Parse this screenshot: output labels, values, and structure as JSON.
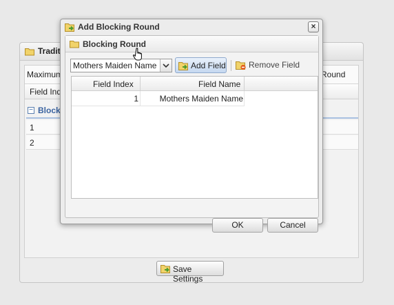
{
  "background": {
    "panel_title": "Traditional",
    "maximum_label": "Maximum",
    "round_label": "Round",
    "field_index_label": "Field Index",
    "blocking_label": "Blocking",
    "rows": [
      "1",
      "2"
    ],
    "save_settings_label": "Save Settings"
  },
  "dialog": {
    "title": "Add Blocking Round",
    "close_symbol": "×",
    "panel_title": "Blocking Round",
    "field_select": {
      "selected": "Mothers Maiden Name"
    },
    "add_field_label": "Add Field",
    "remove_field_label": "Remove Field",
    "grid": {
      "columns": [
        "Field Index",
        "Field Name"
      ],
      "rows": [
        {
          "index": "1",
          "name": "Mothers Maiden Name"
        }
      ]
    },
    "ok_label": "OK",
    "cancel_label": "Cancel"
  },
  "colors": {
    "folder_icon": "#f1d36a",
    "add_icon_arrow": "#4f9c2e",
    "remove_icon_minus": "#e25a1c",
    "blocking_heading": "#3a63a0"
  },
  "icons": [
    "folder-icon",
    "add-green-arrow-icon",
    "remove-icon",
    "close-icon",
    "chevron-down-icon",
    "hand-pointer-icon",
    "collapse-icon"
  ]
}
